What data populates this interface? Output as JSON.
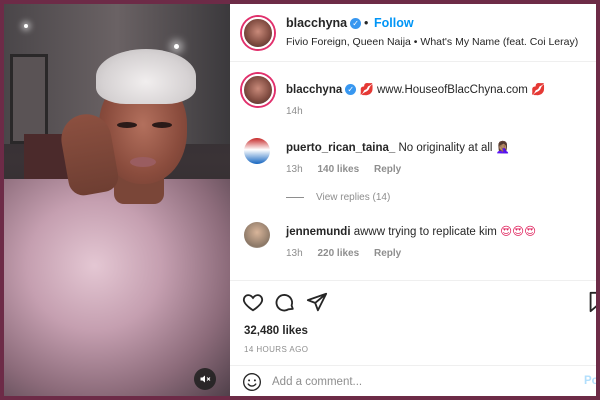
{
  "header": {
    "username": "blacchyna",
    "separator": "•",
    "follow_label": "Follow",
    "song": "Fivio Foreign, Queen Naija • What's My Name (feat. Coi Leray)"
  },
  "caption": {
    "username": "blacchyna",
    "text": "www.HouseofBlacChyna.com",
    "time": "14h"
  },
  "comments": [
    {
      "username": "puerto_rican_taina_",
      "text": "No originality at all",
      "time": "13h",
      "likes": "140 likes",
      "reply": "Reply",
      "view_replies": "View replies (14)"
    },
    {
      "username": "jennemundi",
      "text": "awww trying to replicate kim",
      "time": "13h",
      "likes": "220 likes",
      "reply": "Reply"
    }
  ],
  "footer": {
    "likes": "32,480 likes",
    "time_ago": "14 HOURS AGO",
    "comment_placeholder": "Add a comment...",
    "post_label": "Po"
  },
  "icons": {
    "heart": "heart-icon",
    "comment": "comment-icon",
    "share": "share-icon",
    "save": "bookmark-icon",
    "emoji": "emoji-icon",
    "mute": "mute-icon"
  },
  "colors": {
    "accent": "#0095f6",
    "verified": "#3897f0",
    "frame": "#6d2b47"
  }
}
